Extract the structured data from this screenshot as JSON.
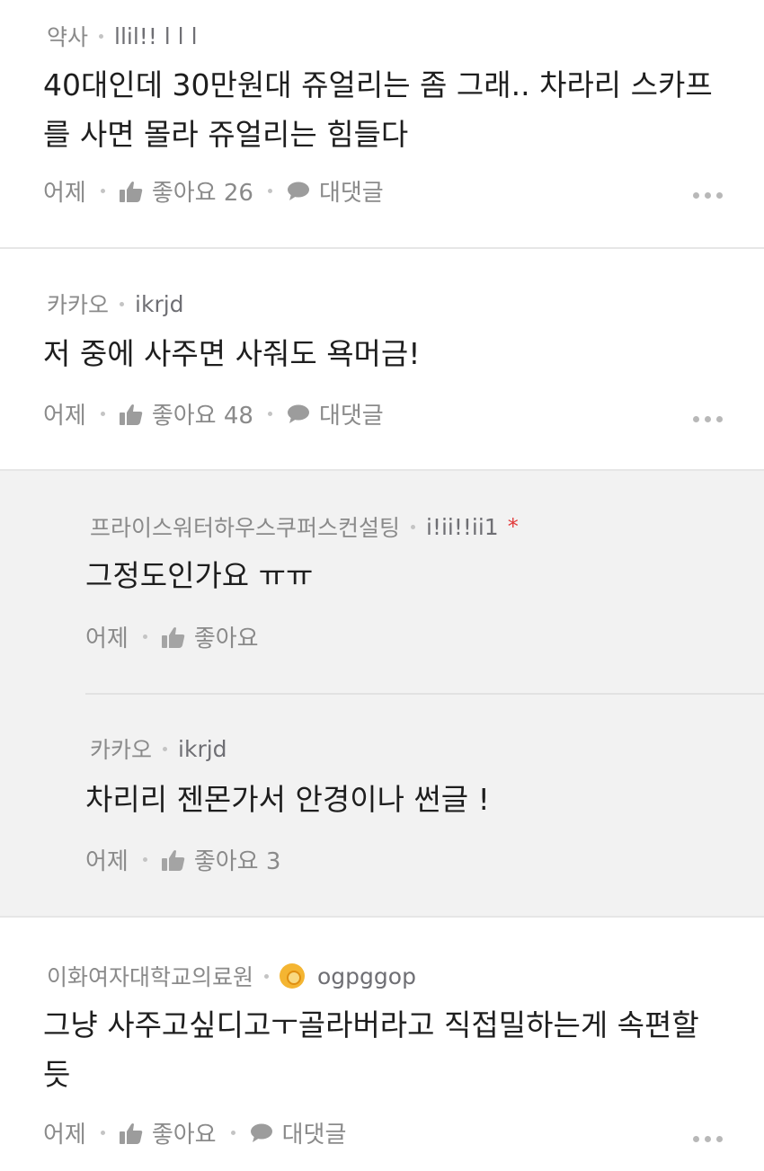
{
  "comments": [
    {
      "affiliation": "약사",
      "username": "llil!! l  l  l",
      "text_lines": [
        "40대인데 30만원대 쥬얼리는 좀 그래.. 차라리 스카프",
        "를 사면 몰라 쥬얼리는 힘들다"
      ],
      "time": "어제",
      "like_label": "좋아요 26",
      "reply_label": "대댓글"
    },
    {
      "affiliation": "카카오",
      "username": "ikrjd",
      "text_lines": [
        "저 중에 사주면 사줘도 욕머금!"
      ],
      "time": "어제",
      "like_label": "좋아요 48",
      "reply_label": "대댓글"
    }
  ],
  "replies": [
    {
      "affiliation": "프라이스워터하우스쿠퍼스컨설팅",
      "username": "i!ii!!ii1",
      "author_marker": "*",
      "text": "그정도인가요 ㅠㅠ",
      "time": "어제",
      "like_label": "좋아요"
    },
    {
      "affiliation": "카카오",
      "username": "ikrjd",
      "text": "차리리 젠몬가서 안경이나 썬글 !",
      "time": "어제",
      "like_label": "좋아요 3"
    }
  ],
  "last_comment": {
    "affiliation": "이화여자대학교의료원",
    "username": "ogpggop",
    "badge_icon": "sun-badge-icon",
    "text_lines": [
      "그냥 사주고싶디고ㅜ골라버라고 직접밀하는게 속편할",
      "듯"
    ],
    "time": "어제",
    "like_label": "좋아요",
    "reply_label": "대댓글"
  },
  "colors": {
    "meta_gray": "#8a8a8a",
    "reply_background": "#f2f2f2",
    "author_marker": "#e23b3b",
    "badge": "#f4b532"
  }
}
